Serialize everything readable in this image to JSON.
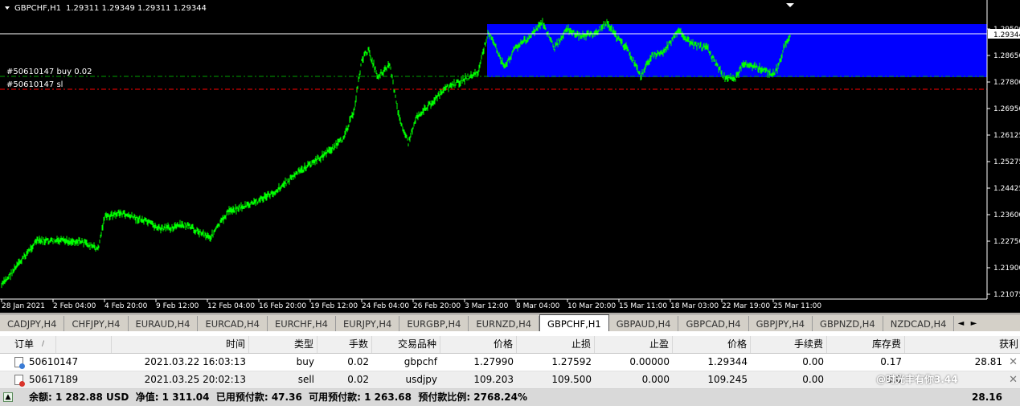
{
  "window": {
    "title": "GBPCHF,H1",
    "ohlc": "1.29311 1.29349 1.29311 1.29344"
  },
  "chart": {
    "colors": {
      "background": "#000000",
      "candles": "#00ff00",
      "box": "#0000ff",
      "buy_line": "#00a000",
      "sl_line": "#ff0000",
      "price_line": "#ffffff",
      "axis_text": "#ffffff"
    },
    "order_labels": [
      "#50610147 buy 0.02",
      "#50610147 sl"
    ],
    "price_ticks": [
      "1.29500",
      "1.28650",
      "1.27800",
      "1.26950",
      "1.26125",
      "1.25275",
      "1.24425",
      "1.23600",
      "1.22750",
      "1.21900",
      "1.21075"
    ],
    "current_price": "1.29344",
    "time_ticks": [
      "28 Jan 2021",
      "2 Feb 04:00",
      "4 Feb 20:00",
      "9 Feb 12:00",
      "12 Feb 04:00",
      "16 Feb 20:00",
      "19 Feb 12:00",
      "24 Feb 04:00",
      "26 Feb 20:00",
      "3 Mar 12:00",
      "8 Mar 04:00",
      "10 Mar 20:00",
      "15 Mar 11:00",
      "18 Mar 03:00",
      "22 Mar 19:00",
      "25 Mar 11:00"
    ]
  },
  "tabs": {
    "items": [
      "CADJPY,H4",
      "CHFJPY,H4",
      "EURAUD,H4",
      "EURCAD,H4",
      "EURCHF,H4",
      "EURJPY,H4",
      "EURGBP,H4",
      "EURNZD,H4",
      "GBPCHF,H1",
      "GBPAUD,H4",
      "GBPCAD,H4",
      "GBPJPY,H4",
      "GBPNZD,H4",
      "NZDCAD,H4"
    ],
    "active": "GBPCHF,H1",
    "nav_left": "◄",
    "nav_right": "►"
  },
  "terminal": {
    "columns": [
      "订单",
      "/",
      "时间",
      "类型",
      "手数",
      "交易品种",
      "价格",
      "止损",
      "止盈",
      "价格",
      "手续费",
      "库存费",
      "获利"
    ],
    "rows": [
      {
        "order": "50610147",
        "time": "2021.03.22 16:03:13",
        "type": "buy",
        "lots": "0.02",
        "symbol": "gbpchf",
        "price": "1.27990",
        "sl": "1.27592",
        "tp": "0.00000",
        "cur_price": "1.29344",
        "commission": "0.00",
        "swap": "0.17",
        "profit": "28.81"
      },
      {
        "order": "50617189",
        "time": "2021.03.25 20:02:13",
        "type": "sell",
        "lots": "0.02",
        "symbol": "usdjpy",
        "price": "109.203",
        "sl": "109.500",
        "tp": "0.000",
        "cur_price": "109.245",
        "commission": "0.00",
        "swap": "0.0",
        "profit": ""
      }
    ],
    "balance_line": "余额: 1 282.88 USD  净值: 1 311.04  已用预付款: 47.36  可用预付款: 1 263.68  预付款比例: 2768.24%",
    "total_profit": "28.16",
    "watermark": "@时光丰有你3.44"
  }
}
